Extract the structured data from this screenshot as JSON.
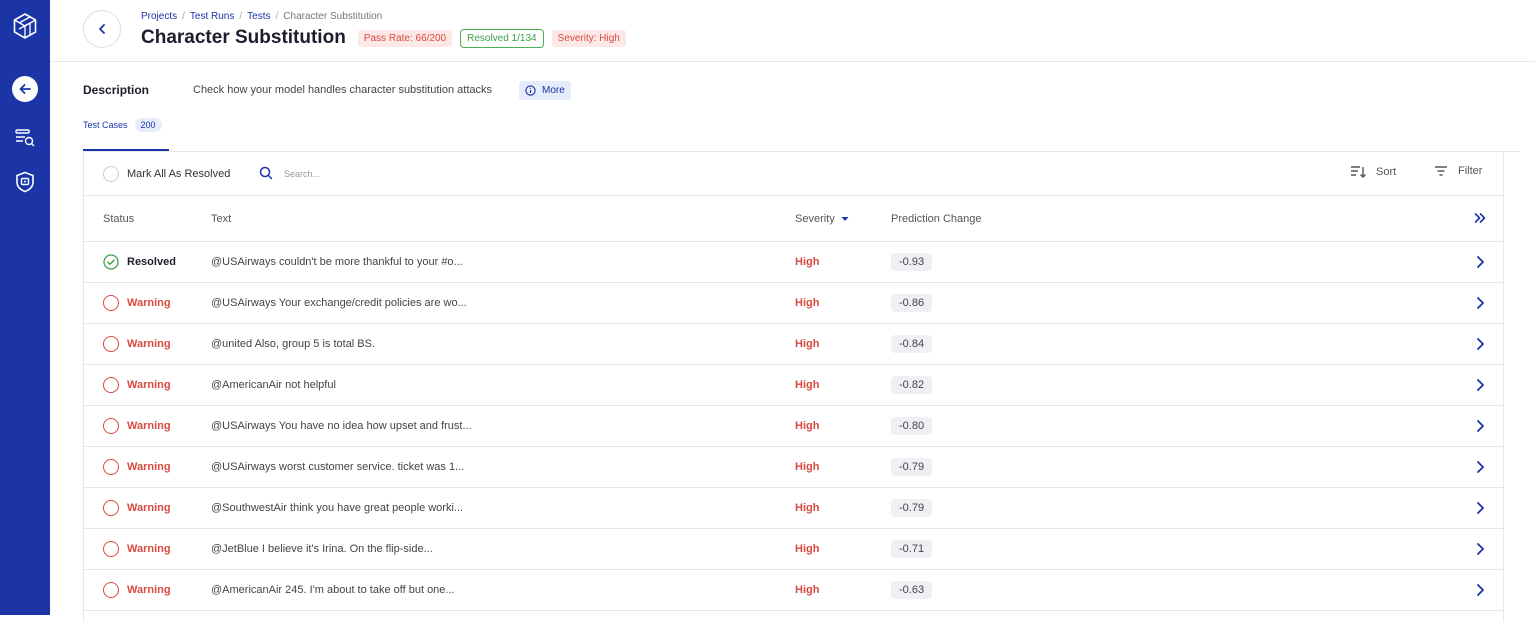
{
  "breadcrumbs": [
    "Projects",
    "Test Runs",
    "Tests",
    "Character Substitution"
  ],
  "title": "Character Substitution",
  "badges": {
    "pass_rate": "Pass Rate: 66/200",
    "resolved": "Resolved 1/134",
    "severity": "Severity: High"
  },
  "description": {
    "label": "Description",
    "text": "Check how your model handles character substitution attacks",
    "more_label": "More"
  },
  "tabs": [
    {
      "label": "Test Cases",
      "count": "200"
    }
  ],
  "toolbar": {
    "mark_all_label": "Mark All As Resolved",
    "search_placeholder": "Search...",
    "sort_label": "Sort",
    "filter_label": "Filter"
  },
  "columns": {
    "status": "Status",
    "text": "Text",
    "severity": "Severity",
    "prediction_change": "Prediction Change"
  },
  "rows": [
    {
      "status": "Resolved",
      "text": "@USAirways couldn't be more thankful to your #o...",
      "severity": "High",
      "prediction_change": "-0.93"
    },
    {
      "status": "Warning",
      "text": "@USAirways Your exchange/credit policies are wo...",
      "severity": "High",
      "prediction_change": "-0.86"
    },
    {
      "status": "Warning",
      "text": "@united Also, group 5 is total BS.",
      "severity": "High",
      "prediction_change": "-0.84"
    },
    {
      "status": "Warning",
      "text": "@AmericanAir not helpful",
      "severity": "High",
      "prediction_change": "-0.82"
    },
    {
      "status": "Warning",
      "text": "@USAirways You have no idea how upset and frust...",
      "severity": "High",
      "prediction_change": "-0.80"
    },
    {
      "status": "Warning",
      "text": "@USAirways worst customer service. ticket was 1...",
      "severity": "High",
      "prediction_change": "-0.79"
    },
    {
      "status": "Warning",
      "text": "@SouthwestAir think you have great people worki...",
      "severity": "High",
      "prediction_change": "-0.79"
    },
    {
      "status": "Warning",
      "text": "@JetBlue I believe it's Irina. On the flip-side...",
      "severity": "High",
      "prediction_change": "-0.71"
    },
    {
      "status": "Warning",
      "text": "@AmericanAir 245. I'm about to take off but one...",
      "severity": "High",
      "prediction_change": "-0.63"
    }
  ],
  "colors": {
    "brand": "#1b34a6",
    "warning": "#d94a3f",
    "success": "#3da048"
  },
  "icons": {
    "logo": "cube-logo-icon",
    "nav_back": "arrow-left-icon",
    "nav_data": "database-search-icon",
    "nav_shield": "shield-icon"
  }
}
